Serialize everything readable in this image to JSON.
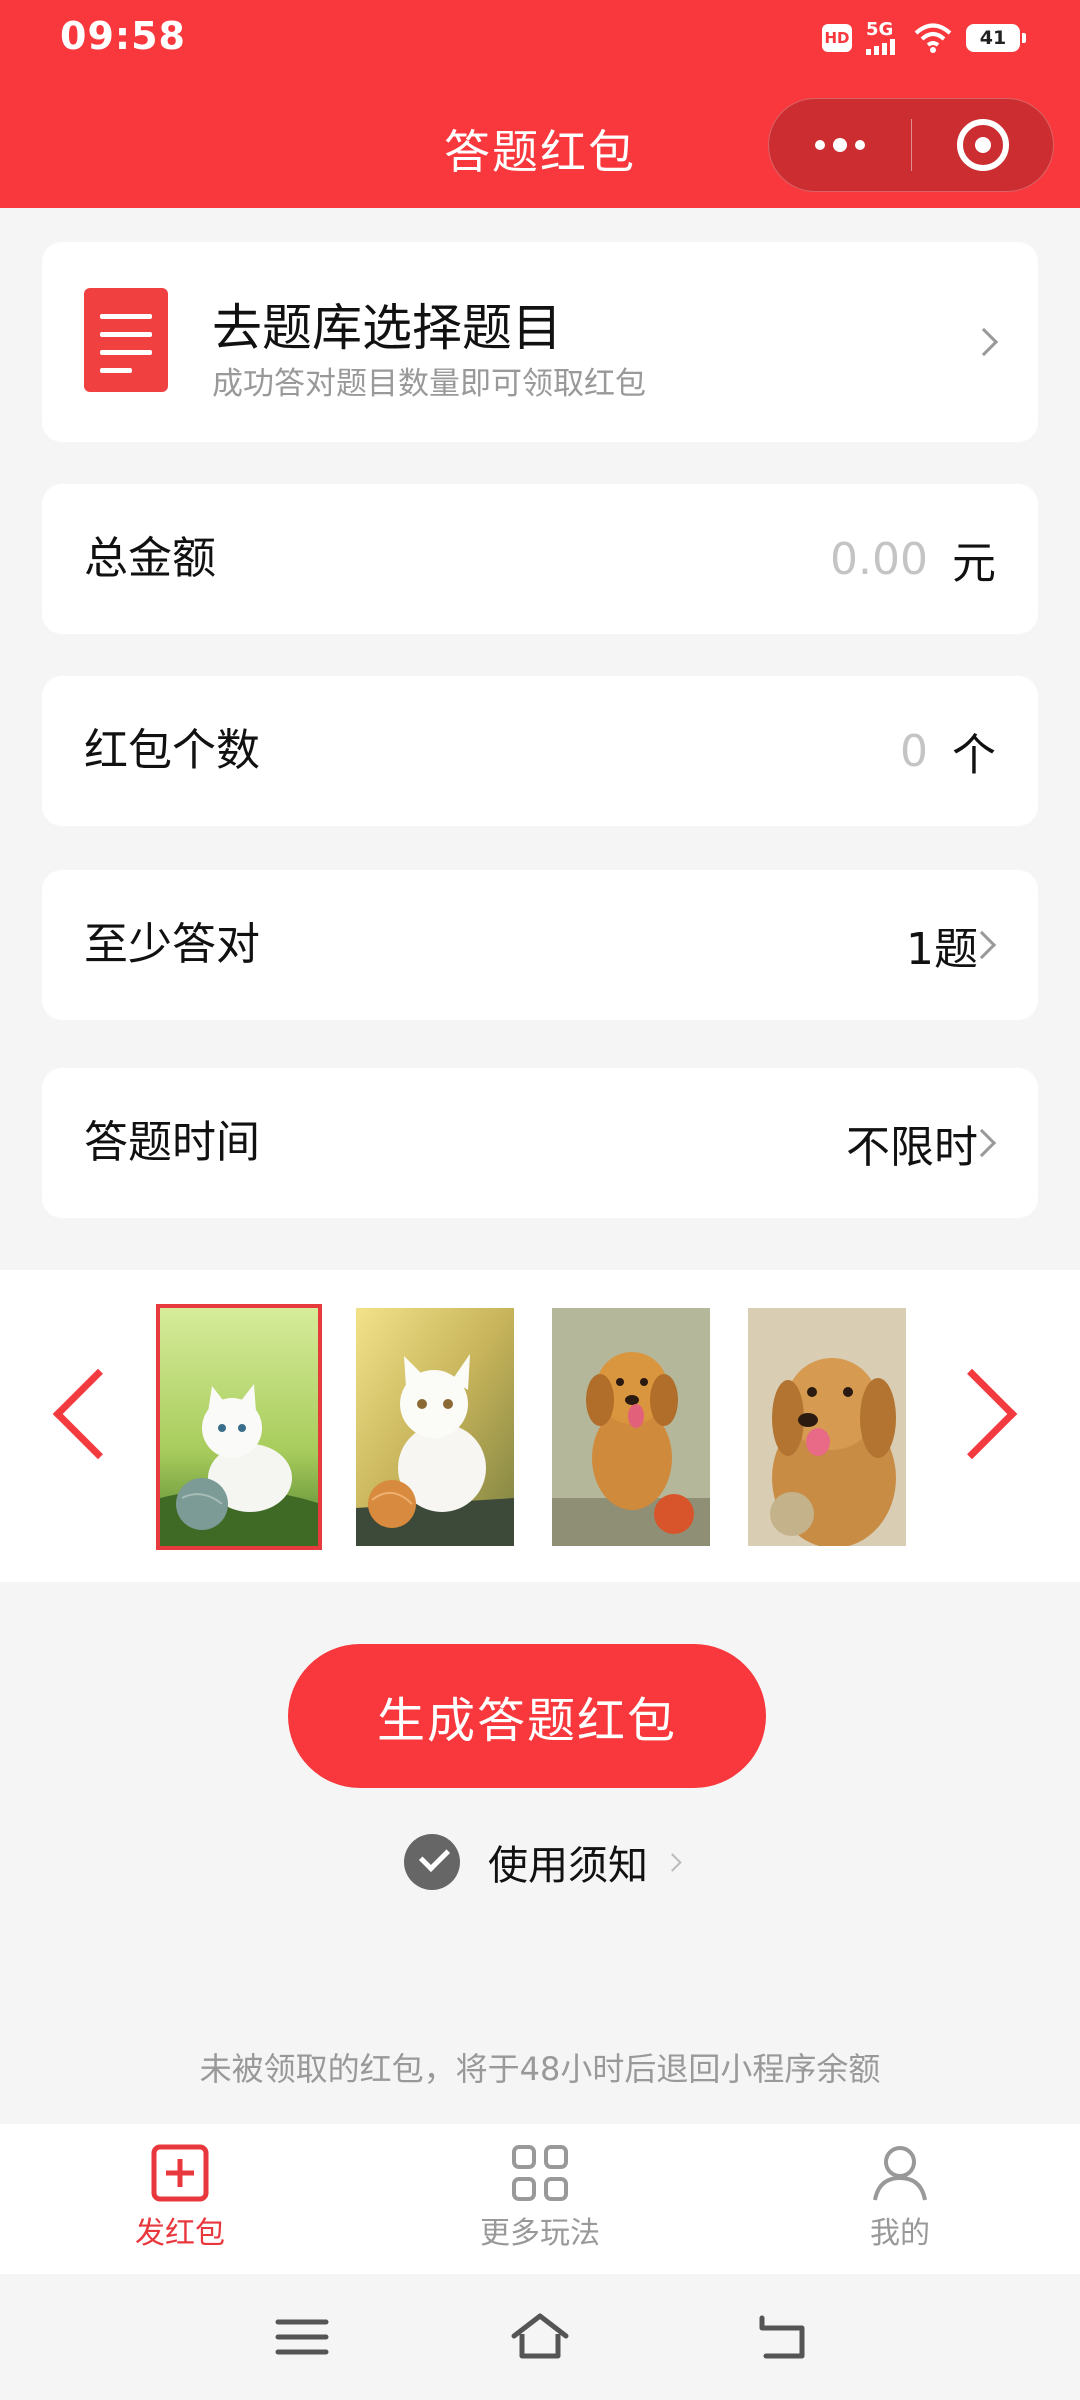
{
  "status_bar": {
    "time": "09:58",
    "hd": "HD",
    "network": "5G",
    "battery": "41"
  },
  "nav": {
    "title": "答题红包"
  },
  "question_bank": {
    "title": "去题库选择题目",
    "subtitle": "成功答对题目数量即可领取红包"
  },
  "fields": {
    "total_amount": {
      "label": "总金额",
      "placeholder": "0.00",
      "unit": "元"
    },
    "packet_count": {
      "label": "红包个数",
      "placeholder": "0",
      "unit": "个"
    },
    "min_correct": {
      "label": "至少答对",
      "value": "1题"
    },
    "answer_time": {
      "label": "答题时间",
      "value": "不限时"
    }
  },
  "gallery": {
    "selected_index": 0,
    "images": [
      "white-kitten-with-yarn",
      "white-kitten-with-yarn-ball",
      "golden-retriever-with-ball",
      "golden-retriever-portrait"
    ],
    "accent_color": "#f23a3f"
  },
  "actions": {
    "generate_label": "生成答题红包",
    "notice_label": "使用须知"
  },
  "footnote": "未被领取的红包，将于48小时后退回小程序余额",
  "tabbar": {
    "items": [
      {
        "label": "发红包",
        "icon": "add-square-icon",
        "active": true
      },
      {
        "label": "更多玩法",
        "icon": "grid-icon",
        "active": false
      },
      {
        "label": "我的",
        "icon": "user-icon",
        "active": false
      }
    ]
  },
  "colors": {
    "brand": "#f8383c",
    "background": "#f5f5f5",
    "muted": "#999999"
  }
}
